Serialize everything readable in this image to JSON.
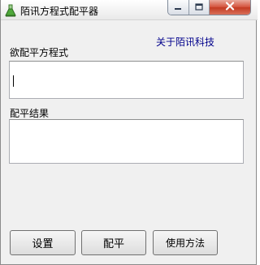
{
  "window": {
    "title": "陌讯方程式配平器",
    "icon": "green-flask-icon"
  },
  "caption_buttons": {
    "minimize": "minimize-icon",
    "maximize": "maximize-icon",
    "close": "close-icon"
  },
  "links": {
    "about": "关于陌讯科技"
  },
  "input_section": {
    "label": "欲配平方程式",
    "value": ""
  },
  "result_section": {
    "label": "配平结果",
    "value": ""
  },
  "buttons": {
    "settings": "设置",
    "balance": "配平",
    "help": "使用方法"
  },
  "colors": {
    "link": "#00008b",
    "close_button": "#c94a35"
  }
}
